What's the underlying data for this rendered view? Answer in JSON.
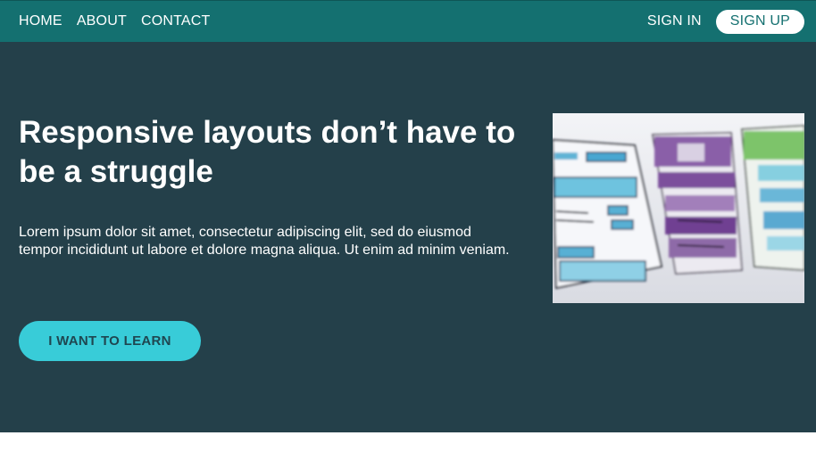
{
  "nav": {
    "links": [
      {
        "label": "HOME"
      },
      {
        "label": "ABOUT"
      },
      {
        "label": "CONTACT"
      }
    ],
    "sign_in_label": "SIGN IN",
    "sign_up_label": "SIGN UP"
  },
  "hero": {
    "title": "Responsive layouts don’t have to be a struggle",
    "text": "Lorem ipsum dolor sit amet, consectetur adipiscing elit, sed do eiusmod tempor incididunt ut labore et dolore magna aliqua. Ut enim ad minim veniam.",
    "cta_label": "I WANT TO LEARN"
  },
  "colors": {
    "topbar": "#147070",
    "hero_background": "#24404a",
    "cta_background": "#38ccd8",
    "cta_text": "#1f4650",
    "text": "#ffffff"
  }
}
